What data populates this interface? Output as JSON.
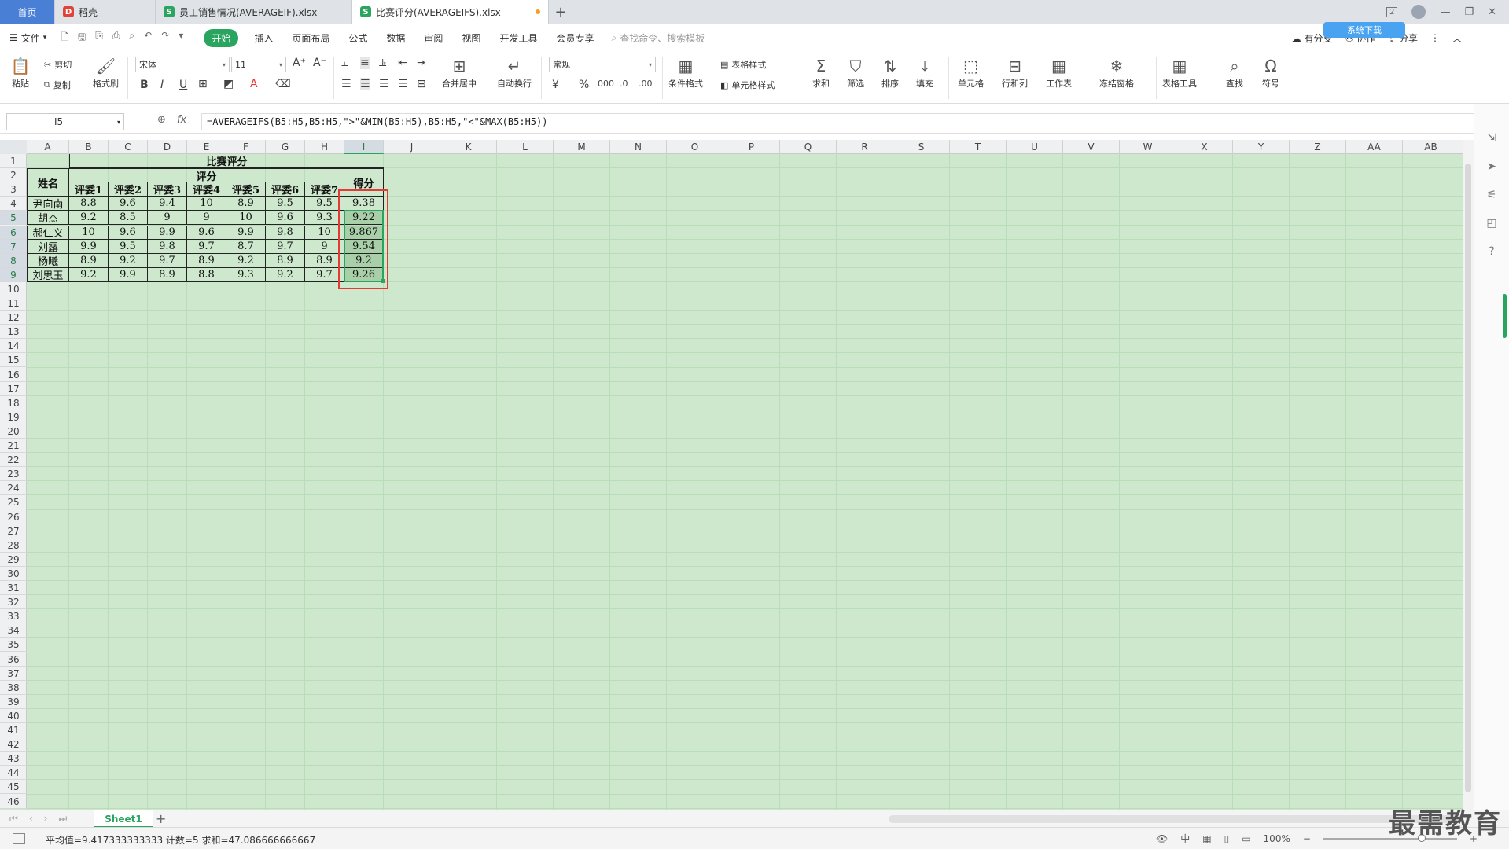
{
  "tabs": [
    {
      "label": "首页"
    },
    {
      "label": "稻壳"
    },
    {
      "label": "员工销售情况(AVERAGEIF).xlsx"
    },
    {
      "label": "比赛评分(AVERAGEIFS).xlsx"
    }
  ],
  "window": {
    "page_count_badge": "2"
  },
  "menu": {
    "file": "文件",
    "items": [
      "开始",
      "插入",
      "页面布局",
      "公式",
      "数据",
      "审阅",
      "视图",
      "开发工具",
      "会员专享"
    ],
    "active": "开始",
    "search_placeholder": "查找命令、搜索模板",
    "right": [
      "有分支",
      "协作",
      "分享"
    ],
    "cloud_badge": "系统下载"
  },
  "ribbon": {
    "paste": "粘贴",
    "cut": "剪切",
    "copy": "复制",
    "format_painter": "格式刷",
    "font_name": "宋体",
    "font_size": "11",
    "merge_center": "合并居中",
    "wrap_text": "自动换行",
    "number_format": "常规",
    "table_style": "表格样式",
    "cond_format": "条件格式",
    "cell_style": "单元格样式",
    "sum": "求和",
    "filter": "筛选",
    "sort": "排序",
    "fill": "填充",
    "cell": "单元格",
    "row_col": "行和列",
    "worksheet": "工作表",
    "freeze": "冻结窗格",
    "table_tools": "表格工具",
    "find": "查找",
    "symbol": "符号"
  },
  "formula_bar": {
    "cell_ref": "I5",
    "fx_label": "fx",
    "formula": "=AVERAGEIFS(B5:H5,B5:H5,\">\"&MIN(B5:H5),B5:H5,\"<\"&MAX(B5:H5))"
  },
  "columns": [
    "A",
    "B",
    "C",
    "D",
    "E",
    "F",
    "G",
    "H",
    "I",
    "J",
    "K",
    "L",
    "M",
    "N",
    "O",
    "P",
    "Q",
    "R",
    "S",
    "T",
    "U",
    "V",
    "W",
    "X",
    "Y",
    "Z",
    "AA",
    "AB"
  ],
  "selected_column": "I",
  "sheet": {
    "title": "比赛评分",
    "name_header": "姓名",
    "score_group": "评分",
    "result_header": "得分",
    "judges": [
      "评委1",
      "评委2",
      "评委3",
      "评委4",
      "评委5",
      "评委6",
      "评委7"
    ],
    "rows": [
      {
        "name": "尹向南",
        "scores": [
          "8.8",
          "9.6",
          "9.4",
          "10",
          "8.9",
          "9.5",
          "9.5"
        ],
        "result": "9.38"
      },
      {
        "name": "胡杰",
        "scores": [
          "9.2",
          "8.5",
          "9",
          "9",
          "10",
          "9.6",
          "9.3"
        ],
        "result": "9.22"
      },
      {
        "name": "郝仁义",
        "scores": [
          "10",
          "9.6",
          "9.9",
          "9.6",
          "9.9",
          "9.8",
          "10"
        ],
        "result": "9.867"
      },
      {
        "name": "刘露",
        "scores": [
          "9.9",
          "9.5",
          "9.8",
          "9.7",
          "8.7",
          "9.7",
          "9"
        ],
        "result": "9.54"
      },
      {
        "name": "杨曦",
        "scores": [
          "8.9",
          "9.2",
          "9.7",
          "8.9",
          "9.2",
          "8.9",
          "8.9"
        ],
        "result": "9.2"
      },
      {
        "name": "刘思玉",
        "scores": [
          "9.2",
          "9.9",
          "8.9",
          "8.8",
          "9.3",
          "9.2",
          "9.7"
        ],
        "result": "9.26"
      }
    ]
  },
  "sheet_tabs": {
    "active": "Sheet1"
  },
  "status": {
    "summary": "平均值=9.417333333333  计数=5  求和=47.086666666667",
    "zoom": "100%"
  },
  "watermark": "最需教育"
}
